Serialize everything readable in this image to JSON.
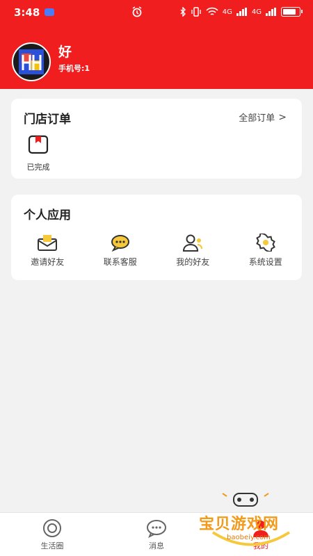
{
  "status_bar": {
    "time": "3:48",
    "signal_label_1": "4G",
    "signal_label_2": "4G"
  },
  "profile": {
    "name": "好",
    "phone": "手机号:1"
  },
  "orders": {
    "title": "门店订单",
    "all_label": "全部订单",
    "statuses": [
      {
        "label": "已完成",
        "icon": "completed-box-icon"
      }
    ]
  },
  "apps": {
    "title": "个人应用",
    "items": [
      {
        "label": "邀请好友",
        "icon": "envelope-icon"
      },
      {
        "label": "联系客服",
        "icon": "chat-bubble-icon"
      },
      {
        "label": "我的好友",
        "icon": "friends-icon"
      },
      {
        "label": "系统设置",
        "icon": "gear-icon"
      }
    ]
  },
  "tabs": [
    {
      "label": "生活圈",
      "icon": "target-icon"
    },
    {
      "label": "消息",
      "icon": "message-icon"
    },
    {
      "label": "我的",
      "icon": "user-icon",
      "active": true
    }
  ],
  "watermark": {
    "text": "宝贝游戏网",
    "url": "baobeiy.com"
  },
  "colors": {
    "brand": "#f01e1e",
    "accent": "#f29a1a"
  }
}
